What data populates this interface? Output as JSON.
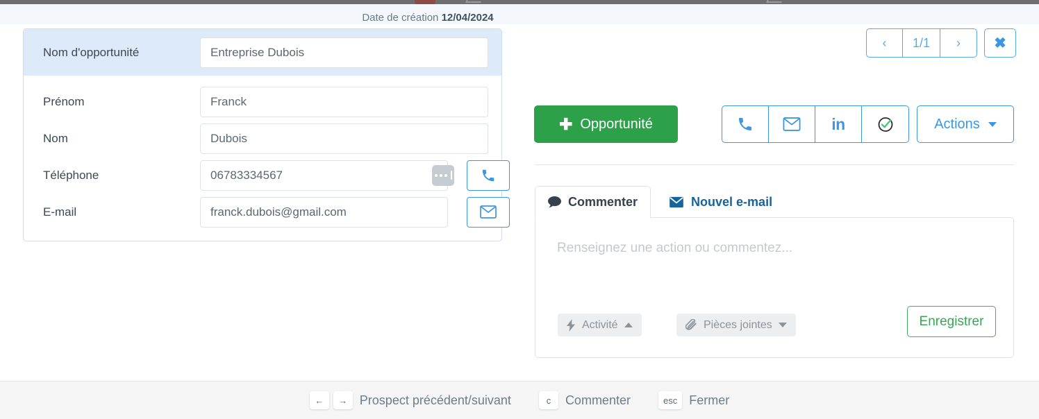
{
  "header": {
    "date_label": "Date de création",
    "date_value": "12/04/2024"
  },
  "pagination": {
    "prev_label": "‹",
    "page_indicator": "1/1",
    "next_label": "›",
    "close_label": "✖"
  },
  "form": {
    "opportunity": {
      "label": "Nom d'opportunité",
      "value": "Entreprise Dubois"
    },
    "fields": [
      {
        "label": "Prénom",
        "value": "Franck"
      },
      {
        "label": "Nom",
        "value": "Dubois"
      },
      {
        "label": "Téléphone",
        "value": "06783334567"
      },
      {
        "label": "E-mail",
        "value": "franck.dubois@gmail.com"
      }
    ]
  },
  "actions": {
    "opportunity_button": "Opportunité",
    "opportunity_plus": "✚",
    "icons": [
      "phone-icon",
      "envelope-icon",
      "linkedin-icon",
      "check-circle-icon"
    ],
    "linkedin_text": "in",
    "actions_button": "Actions"
  },
  "comment_panel": {
    "tabs": [
      {
        "label": "Commenter",
        "icon": "speech-bubble-icon",
        "active": true
      },
      {
        "label": "Nouvel e-mail",
        "icon": "envelope-icon",
        "active": false
      }
    ],
    "placeholder": "Renseignez une action ou commentez...",
    "activity_label": "Activité",
    "attachments_label": "Pièces jointes",
    "save_label": "Enregistrer"
  },
  "footer": {
    "key_left": "←",
    "key_right": "→",
    "nav_text": "Prospect précédent/suivant",
    "key_c": "c",
    "comment_text": "Commenter",
    "key_esc": "esc",
    "close_text": "Fermer"
  },
  "colors": {
    "accent_blue": "#3b97e3",
    "green": "#2ca14a",
    "highlight_row": "#ddeafa",
    "tab_active_text": "#35424c",
    "tab_inactive_text": "#17639c"
  }
}
